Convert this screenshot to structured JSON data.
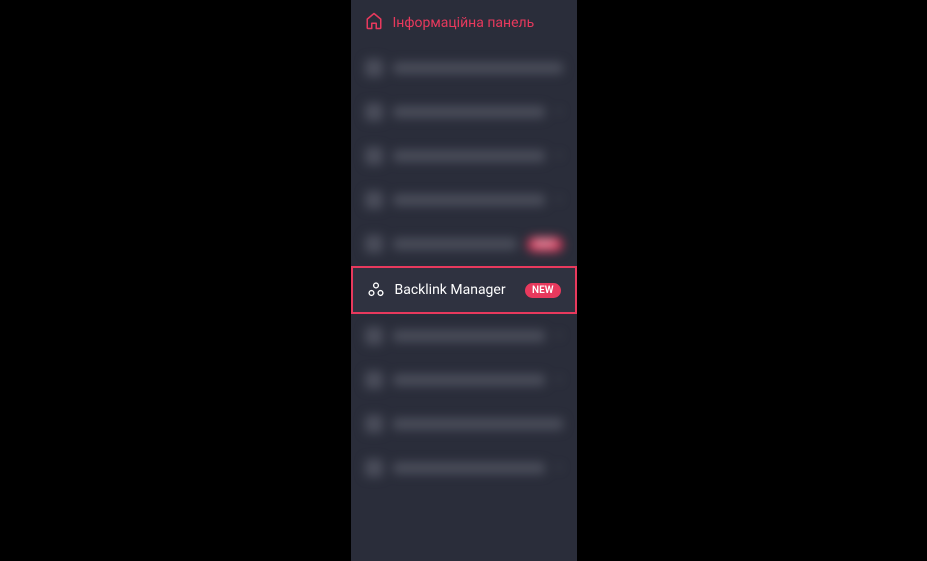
{
  "colors": {
    "accent": "#e8395d",
    "sidebar_bg": "#2a2d3a",
    "text_muted": "#a8aab5",
    "text_active": "#ffffff"
  },
  "sidebar": {
    "header": {
      "label": "Інформаційна панель"
    },
    "highlighted_item": {
      "label": "Backlink Manager",
      "badge": "NEW"
    }
  }
}
